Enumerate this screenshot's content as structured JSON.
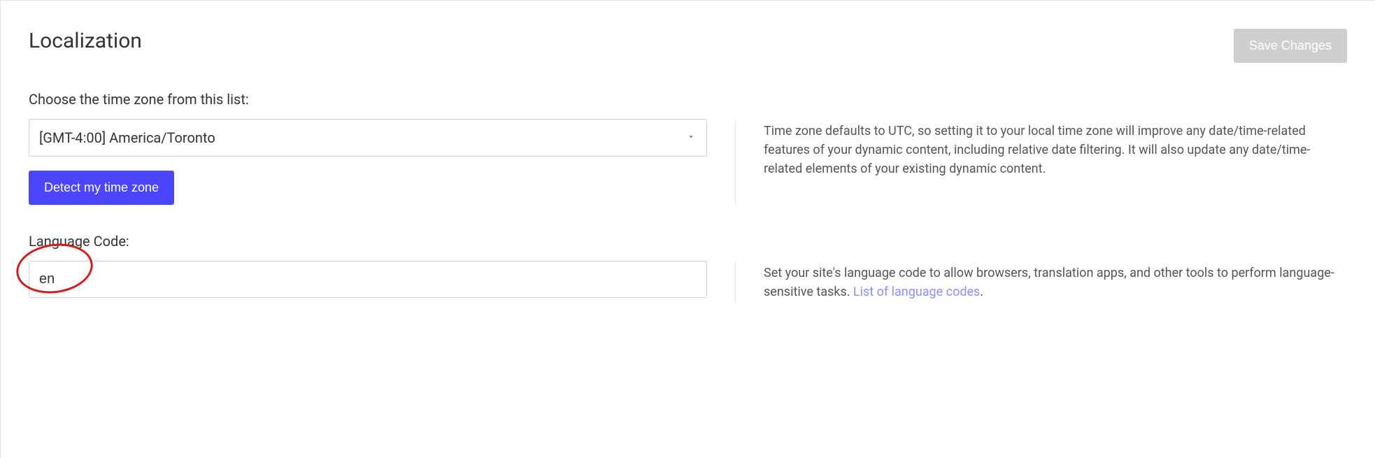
{
  "header": {
    "title": "Localization",
    "save_label": "Save Changes"
  },
  "timezone": {
    "label": "Choose the time zone from this list:",
    "selected": "[GMT-4:00] America/Toronto",
    "detect_label": "Detect my time zone",
    "help": "Time zone defaults to UTC, so setting it to your local time zone will improve any date/time-related features of your dynamic content, including relative date filtering. It will also update any date/time-related elements of your existing dynamic content."
  },
  "language": {
    "label": "Language Code:",
    "value": "en",
    "help_prefix": "Set your site's language code to allow browsers, translation apps, and other tools to perform language-sensitive tasks. ",
    "link_label": "List of language codes",
    "help_suffix": "."
  }
}
